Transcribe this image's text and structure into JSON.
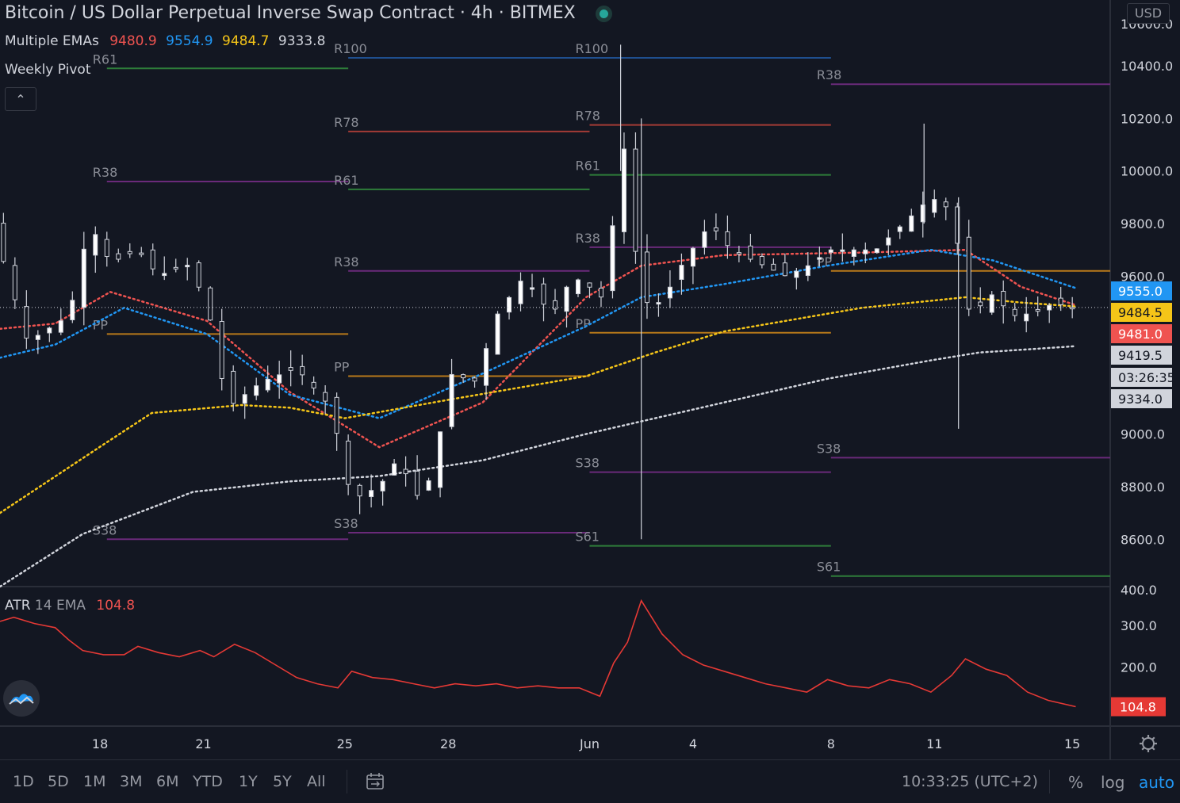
{
  "header": {
    "title": "Bitcoin / US Dollar Perpetual Inverse Swap Contract · 4h · BITMEX",
    "ema_label": "Multiple EMAs",
    "ema_values": [
      "9480.9",
      "9554.9",
      "9484.7",
      "9333.8"
    ],
    "pivot_label": "Weekly Pivot",
    "atr_label": "ATR",
    "atr_params": "14 EMA",
    "atr_value": "104.8",
    "currency": "USD"
  },
  "colors": {
    "background": "#131722",
    "ema_fast": "#ef5350",
    "ema_blue": "#2196f3",
    "ema_yellow": "#f5c518",
    "ema_white": "#d1d4dc",
    "pivot_r100": "#1f4f8f",
    "pivot_r78": "#a33b36",
    "pivot_r61": "#2e7d3a",
    "pivot_r38": "#6a2a7a",
    "pivot_pp": "#b8791a",
    "atr_line": "#e53935"
  },
  "toolbar": {
    "timeframes": [
      "1D",
      "5D",
      "1M",
      "3M",
      "6M",
      "YTD",
      "1Y",
      "5Y",
      "All"
    ],
    "clock": "10:33:25 (UTC+2)",
    "percent": "%",
    "log": "log",
    "auto": "auto"
  },
  "chart_data": [
    {
      "type": "candlestick",
      "title": "Bitcoin / US Dollar Perpetual Inverse Swap Contract · 4h · BITMEX",
      "x_ticks": [
        "18",
        "21",
        "25",
        "28",
        "Jun",
        "4",
        "8",
        "11",
        "15"
      ],
      "y_ticks": [
        "10400.0",
        "10200.0",
        "10000.0",
        "9800.0",
        "9600.0",
        "9000.0",
        "8800.0",
        "8600.0",
        "400.0"
      ],
      "y_top_partial": "10600.0",
      "ylim": [
        8420,
        10650
      ],
      "price_tags": [
        {
          "label": "9555.0",
          "price": 9555.0,
          "color": "#2196f3",
          "text": "#ffffff"
        },
        {
          "label": "9484.5",
          "price": 9484.5,
          "color": "#f5c518",
          "text": "#131722"
        },
        {
          "label": "9481.0",
          "price": 9481.0,
          "color": "#ef5350",
          "text": "#ffffff"
        },
        {
          "label": "9419.5",
          "price": 9419.5,
          "color": "#d1d4dc",
          "text": "#131722"
        },
        {
          "label": "03:26:35",
          "price": 9336.0,
          "color": "#d1d4dc",
          "text": "#131722"
        },
        {
          "label": "9334.0",
          "price": 9250.0,
          "color": "#d1d4dc",
          "text": "#131722"
        }
      ],
      "last_price": 9481.0,
      "ema_series": [
        {
          "color": "#ef5350",
          "points": [
            [
              0,
              9400
            ],
            [
              0.8,
              9420
            ],
            [
              1.6,
              9540
            ],
            [
              3,
              9430
            ],
            [
              4.2,
              9160
            ],
            [
              5.5,
              8950
            ],
            [
              7.0,
              9120
            ],
            [
              8.5,
              9520
            ],
            [
              9.3,
              9640
            ],
            [
              10.5,
              9680
            ],
            [
              12.5,
              9690
            ],
            [
              14.0,
              9700
            ],
            [
              14.8,
              9560
            ],
            [
              15.6,
              9490
            ]
          ]
        },
        {
          "color": "#2196f3",
          "points": [
            [
              0,
              9290
            ],
            [
              0.8,
              9340
            ],
            [
              1.8,
              9480
            ],
            [
              3,
              9380
            ],
            [
              4.2,
              9150
            ],
            [
              5.5,
              9060
            ],
            [
              7.0,
              9230
            ],
            [
              8.5,
              9410
            ],
            [
              9.3,
              9520
            ],
            [
              10.5,
              9570
            ],
            [
              12.0,
              9640
            ],
            [
              13.5,
              9700
            ],
            [
              14.4,
              9660
            ],
            [
              15.6,
              9555
            ]
          ]
        },
        {
          "color": "#f5c518",
          "points": [
            [
              0,
              8700
            ],
            [
              1.5,
              8960
            ],
            [
              2.2,
              9080
            ],
            [
              3.5,
              9110
            ],
            [
              4.2,
              9100
            ],
            [
              5.0,
              9060
            ],
            [
              6.5,
              9130
            ],
            [
              8.5,
              9220
            ],
            [
              9.5,
              9310
            ],
            [
              10.5,
              9390
            ],
            [
              12.5,
              9480
            ],
            [
              14.0,
              9520
            ],
            [
              14.8,
              9500
            ],
            [
              15.6,
              9485
            ]
          ]
        },
        {
          "color": "#d1d4dc",
          "points": [
            [
              0,
              8420
            ],
            [
              1.2,
              8620
            ],
            [
              2.8,
              8780
            ],
            [
              4.2,
              8820
            ],
            [
              5.5,
              8840
            ],
            [
              7.0,
              8900
            ],
            [
              8.5,
              9000
            ],
            [
              9.5,
              9060
            ],
            [
              10.5,
              9120
            ],
            [
              12.0,
              9210
            ],
            [
              13.5,
              9280
            ],
            [
              14.2,
              9310
            ],
            [
              14.8,
              9320
            ],
            [
              15.6,
              9334
            ]
          ]
        }
      ],
      "pivot_levels": [
        {
          "week": 1,
          "x": [
            1.55,
            5.05
          ],
          "levels": [
            {
              "label": "R61",
              "price": 10390,
              "color": "#2e7d3a"
            },
            {
              "label": "R38",
              "price": 9960,
              "color": "#6a2a7a"
            },
            {
              "label": "PP",
              "price": 9380,
              "color": "#b8791a"
            },
            {
              "label": "S38",
              "price": 8600,
              "color": "#6a2a7a"
            }
          ]
        },
        {
          "week": 2,
          "x": [
            5.05,
            8.55
          ],
          "levels": [
            {
              "label": "R100",
              "price": 10430,
              "color": "#1f4f8f"
            },
            {
              "label": "R78",
              "price": 10150,
              "color": "#a33b36"
            },
            {
              "label": "R61",
              "price": 9930,
              "color": "#2e7d3a"
            },
            {
              "label": "R38",
              "price": 9620,
              "color": "#6a2a7a"
            },
            {
              "label": "PP",
              "price": 9220,
              "color": "#b8791a"
            },
            {
              "label": "S38",
              "price": 8625,
              "color": "#6a2a7a"
            }
          ]
        },
        {
          "week": 3,
          "x": [
            8.55,
            12.05
          ],
          "levels": [
            {
              "label": "R100",
              "price": 10430,
              "color": "#1f4f8f"
            },
            {
              "label": "R78",
              "price": 10175,
              "color": "#a33b36"
            },
            {
              "label": "R61",
              "price": 9985,
              "color": "#2e7d3a"
            },
            {
              "label": "R38",
              "price": 9710,
              "color": "#6a2a7a"
            },
            {
              "label": "PP",
              "price": 9385,
              "color": "#b8791a"
            },
            {
              "label": "S38",
              "price": 8855,
              "color": "#6a2a7a"
            },
            {
              "label": "S61",
              "price": 8575,
              "color": "#2e7d3a"
            }
          ]
        },
        {
          "week": 4,
          "x": [
            12.05,
            16.1
          ],
          "levels": [
            {
              "label": "R38",
              "price": 10330,
              "color": "#6a2a7a"
            },
            {
              "label": "PP",
              "price": 9620,
              "color": "#b8791a"
            },
            {
              "label": "S38",
              "price": 8910,
              "color": "#6a2a7a"
            },
            {
              "label": "S61",
              "price": 8460,
              "color": "#2e7d3a"
            }
          ]
        }
      ],
      "price_path": [
        [
          0,
          9700
        ],
        [
          0.4,
          9350
        ],
        [
          1.0,
          9450
        ],
        [
          1.3,
          9800
        ],
        [
          1.6,
          9650
        ],
        [
          2.0,
          9700
        ],
        [
          2.3,
          9600
        ],
        [
          2.7,
          9650
        ],
        [
          3.0,
          9500
        ],
        [
          3.3,
          9100
        ],
        [
          3.8,
          9200
        ],
        [
          4.3,
          9250
        ],
        [
          4.8,
          9100
        ],
        [
          5.1,
          8750
        ],
        [
          5.5,
          8800
        ],
        [
          5.8,
          8920
        ],
        [
          6.0,
          8750
        ],
        [
          6.3,
          8850
        ],
        [
          6.5,
          9230
        ],
        [
          6.9,
          9200
        ],
        [
          7.2,
          9450
        ],
        [
          7.6,
          9600
        ],
        [
          8.0,
          9450
        ],
        [
          8.3,
          9600
        ],
        [
          8.6,
          9550
        ],
        [
          8.8,
          9500
        ],
        [
          9.0,
          10200
        ],
        [
          9.3,
          9500
        ],
        [
          9.6,
          9500
        ],
        [
          9.9,
          9650
        ],
        [
          10.3,
          9800
        ],
        [
          10.6,
          9700
        ],
        [
          11.0,
          9650
        ],
        [
          11.4,
          9600
        ],
        [
          11.8,
          9650
        ],
        [
          12.0,
          9700
        ],
        [
          12.3,
          9700
        ],
        [
          12.7,
          9700
        ],
        [
          13.1,
          9800
        ],
        [
          13.5,
          9900
        ],
        [
          13.8,
          9850
        ],
        [
          14.1,
          9400
        ],
        [
          14.3,
          9550
        ],
        [
          14.7,
          9450
        ],
        [
          15.0,
          9460
        ],
        [
          15.3,
          9500
        ],
        [
          15.5,
          9480
        ]
      ]
    },
    {
      "type": "line",
      "title": "ATR 14 EMA",
      "y_ticks": [
        "300.0",
        "200.0"
      ],
      "ylim": [
        60,
        390
      ],
      "last_value": 104.8,
      "values": [
        [
          0,
          310
        ],
        [
          0.2,
          320
        ],
        [
          0.5,
          305
        ],
        [
          0.8,
          295
        ],
        [
          1.0,
          265
        ],
        [
          1.2,
          240
        ],
        [
          1.5,
          230
        ],
        [
          1.8,
          230
        ],
        [
          2.0,
          250
        ],
        [
          2.3,
          235
        ],
        [
          2.6,
          225
        ],
        [
          2.9,
          240
        ],
        [
          3.1,
          225
        ],
        [
          3.4,
          255
        ],
        [
          3.7,
          235
        ],
        [
          4.0,
          205
        ],
        [
          4.3,
          175
        ],
        [
          4.6,
          160
        ],
        [
          4.9,
          150
        ],
        [
          5.1,
          190
        ],
        [
          5.4,
          175
        ],
        [
          5.7,
          170
        ],
        [
          6.0,
          160
        ],
        [
          6.3,
          150
        ],
        [
          6.6,
          160
        ],
        [
          6.9,
          155
        ],
        [
          7.2,
          160
        ],
        [
          7.5,
          150
        ],
        [
          7.8,
          155
        ],
        [
          8.1,
          150
        ],
        [
          8.4,
          150
        ],
        [
          8.7,
          130
        ],
        [
          8.9,
          210
        ],
        [
          9.1,
          260
        ],
        [
          9.3,
          360
        ],
        [
          9.6,
          280
        ],
        [
          9.9,
          230
        ],
        [
          10.2,
          205
        ],
        [
          10.5,
          190
        ],
        [
          10.8,
          175
        ],
        [
          11.1,
          160
        ],
        [
          11.4,
          150
        ],
        [
          11.7,
          140
        ],
        [
          12.0,
          170
        ],
        [
          12.3,
          155
        ],
        [
          12.6,
          150
        ],
        [
          12.9,
          170
        ],
        [
          13.2,
          160
        ],
        [
          13.5,
          140
        ],
        [
          13.8,
          180
        ],
        [
          14.0,
          220
        ],
        [
          14.3,
          195
        ],
        [
          14.6,
          180
        ],
        [
          14.9,
          140
        ],
        [
          15.2,
          120
        ],
        [
          15.6,
          104.8
        ]
      ]
    }
  ]
}
